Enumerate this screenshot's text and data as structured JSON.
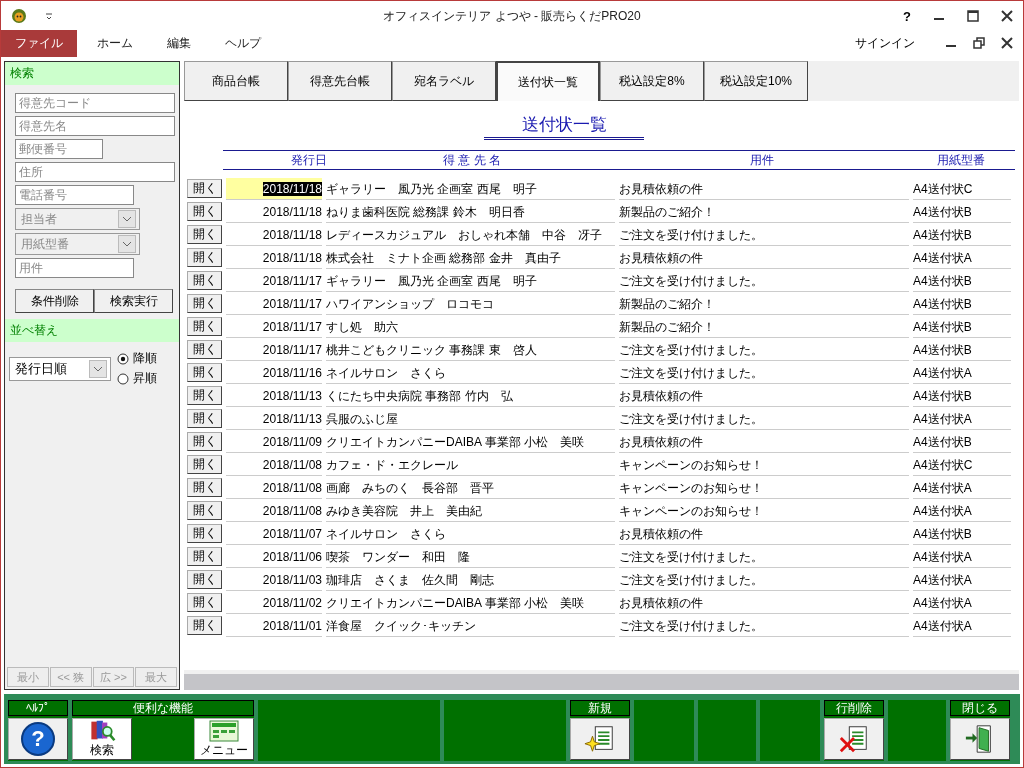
{
  "window": {
    "title": "オフィスインテリア よつや - 販売らくだPRO20",
    "help": "?",
    "signin": "サインイン"
  },
  "menu": [
    {
      "label": "ファイル",
      "selected": true
    },
    {
      "label": "ホーム",
      "selected": false
    },
    {
      "label": "編集",
      "selected": false
    },
    {
      "label": "ヘルプ",
      "selected": false
    }
  ],
  "search": {
    "title": "検索",
    "fields": [
      {
        "kind": "text",
        "placeholder": "得意先コード"
      },
      {
        "kind": "text",
        "placeholder": "得意先名"
      },
      {
        "kind": "text",
        "placeholder": "郵便番号"
      },
      {
        "kind": "text",
        "placeholder": "住所"
      },
      {
        "kind": "text",
        "placeholder": "電話番号"
      },
      {
        "kind": "dropdown",
        "placeholder": "担当者"
      },
      {
        "kind": "dropdown",
        "placeholder": "用紙型番"
      },
      {
        "kind": "text",
        "placeholder": "用件"
      }
    ],
    "buttons": [
      "条件削除",
      "検索実行"
    ]
  },
  "sort": {
    "title": "並べ替え",
    "value": "発行日順",
    "options": [
      {
        "label": "降順",
        "selected": true
      },
      {
        "label": "昇順",
        "selected": false
      }
    ]
  },
  "zoom_buttons": [
    {
      "label": "最小",
      "disabled": true
    },
    {
      "label": "<< 狭",
      "disabled": true
    },
    {
      "label": "広 >>",
      "disabled": true
    },
    {
      "label": "最大",
      "disabled": true
    }
  ],
  "tabs": [
    {
      "label": "商品台帳",
      "selected": false
    },
    {
      "label": "得意先台帳",
      "selected": false
    },
    {
      "label": "宛名ラベル",
      "selected": false
    },
    {
      "label": "送付状一覧",
      "selected": true
    },
    {
      "label": "税込設定8%",
      "selected": false
    },
    {
      "label": "税込設定10%",
      "selected": false
    }
  ],
  "table": {
    "title": "送付状一覧",
    "columns": [
      "発行日",
      "得 意 先 名",
      "用件",
      "用紙型番"
    ],
    "rows": [
      {
        "open": "開く",
        "date": "2018/11/18",
        "customer": "ギャラリー　風乃光 企画室 西尾　明子",
        "subject": "お見積依頼の件",
        "paper": "A4送付状C",
        "selected": true
      },
      {
        "open": "開く",
        "date": "2018/11/18",
        "customer": "ねりま歯科医院 総務課 鈴木　明日香",
        "subject": "新製品のご紹介！",
        "paper": "A4送付状B",
        "selected": false
      },
      {
        "open": "開く",
        "date": "2018/11/18",
        "customer": "レディースカジュアル　おしゃれ本舗　中谷　冴子",
        "subject": "ご注文を受け付けました。",
        "paper": "A4送付状B",
        "selected": false
      },
      {
        "open": "開く",
        "date": "2018/11/18",
        "customer": "株式会社　ミナト企画 総務部 金井　真由子",
        "subject": "お見積依頼の件",
        "paper": "A4送付状A",
        "selected": false
      },
      {
        "open": "開く",
        "date": "2018/11/17",
        "customer": "ギャラリー　風乃光 企画室 西尾　明子",
        "subject": "ご注文を受け付けました。",
        "paper": "A4送付状B",
        "selected": false
      },
      {
        "open": "開く",
        "date": "2018/11/17",
        "customer": "ハワイアンショップ　ロコモコ",
        "subject": "新製品のご紹介！",
        "paper": "A4送付状B",
        "selected": false
      },
      {
        "open": "開く",
        "date": "2018/11/17",
        "customer": "すし処　助六",
        "subject": "新製品のご紹介！",
        "paper": "A4送付状B",
        "selected": false
      },
      {
        "open": "開く",
        "date": "2018/11/17",
        "customer": "桃井こどもクリニック 事務課 東　啓人",
        "subject": "ご注文を受け付けました。",
        "paper": "A4送付状B",
        "selected": false
      },
      {
        "open": "開く",
        "date": "2018/11/16",
        "customer": "ネイルサロン　さくら",
        "subject": "ご注文を受け付けました。",
        "paper": "A4送付状A",
        "selected": false
      },
      {
        "open": "開く",
        "date": "2018/11/13",
        "customer": "くにたち中央病院 事務部 竹内　弘",
        "subject": "お見積依頼の件",
        "paper": "A4送付状B",
        "selected": false
      },
      {
        "open": "開く",
        "date": "2018/11/13",
        "customer": "呉服のふじ屋",
        "subject": "ご注文を受け付けました。",
        "paper": "A4送付状A",
        "selected": false
      },
      {
        "open": "開く",
        "date": "2018/11/09",
        "customer": "クリエイトカンパニーDAIBA 事業部 小松　美咲",
        "subject": "お見積依頼の件",
        "paper": "A4送付状B",
        "selected": false
      },
      {
        "open": "開く",
        "date": "2018/11/08",
        "customer": "カフェ・ド・エクレール",
        "subject": "キャンペーンのお知らせ！",
        "paper": "A4送付状C",
        "selected": false
      },
      {
        "open": "開く",
        "date": "2018/11/08",
        "customer": "画廊　みちのく　長谷部　晋平",
        "subject": "キャンペーンのお知らせ！",
        "paper": "A4送付状A",
        "selected": false
      },
      {
        "open": "開く",
        "date": "2018/11/08",
        "customer": "みゆき美容院　井上　美由紀",
        "subject": "キャンペーンのお知らせ！",
        "paper": "A4送付状A",
        "selected": false
      },
      {
        "open": "開く",
        "date": "2018/11/07",
        "customer": "ネイルサロン　さくら",
        "subject": "お見積依頼の件",
        "paper": "A4送付状B",
        "selected": false
      },
      {
        "open": "開く",
        "date": "2018/11/06",
        "customer": "喫茶　ワンダー　和田　隆",
        "subject": "ご注文を受け付けました。",
        "paper": "A4送付状A",
        "selected": false
      },
      {
        "open": "開く",
        "date": "2018/11/03",
        "customer": "珈琲店　さくま　佐久間　剛志",
        "subject": "ご注文を受け付けました。",
        "paper": "A4送付状A",
        "selected": false
      },
      {
        "open": "開く",
        "date": "2018/11/02",
        "customer": "クリエイトカンパニーDAIBA 事業部 小松　美咲",
        "subject": "お見積依頼の件",
        "paper": "A4送付状A",
        "selected": false
      },
      {
        "open": "開く",
        "date": "2018/11/01",
        "customer": "洋食屋　クイック･キッチン",
        "subject": "ご注文を受け付けました。",
        "paper": "A4送付状A",
        "selected": false
      }
    ]
  },
  "toolbar": [
    {
      "kind": "group",
      "label": "ﾍﾙﾌﾟ",
      "buttons": [
        {
          "kind": "help",
          "glyph": "?"
        }
      ]
    },
    {
      "kind": "group",
      "label": "便利な機能",
      "buttons": [
        {
          "kind": "search",
          "label": "検索"
        },
        {
          "kind": "menu",
          "label": "メニュー"
        }
      ]
    },
    {
      "kind": "empty"
    },
    {
      "kind": "empty"
    },
    {
      "kind": "group",
      "label": "新規",
      "buttons": [
        {
          "kind": "new"
        }
      ]
    },
    {
      "kind": "empty"
    },
    {
      "kind": "empty"
    },
    {
      "kind": "empty"
    },
    {
      "kind": "group",
      "label": "行削除",
      "buttons": [
        {
          "kind": "delete"
        }
      ]
    },
    {
      "kind": "empty"
    },
    {
      "kind": "group",
      "label": "閉じる",
      "buttons": [
        {
          "kind": "exit"
        }
      ]
    }
  ]
}
